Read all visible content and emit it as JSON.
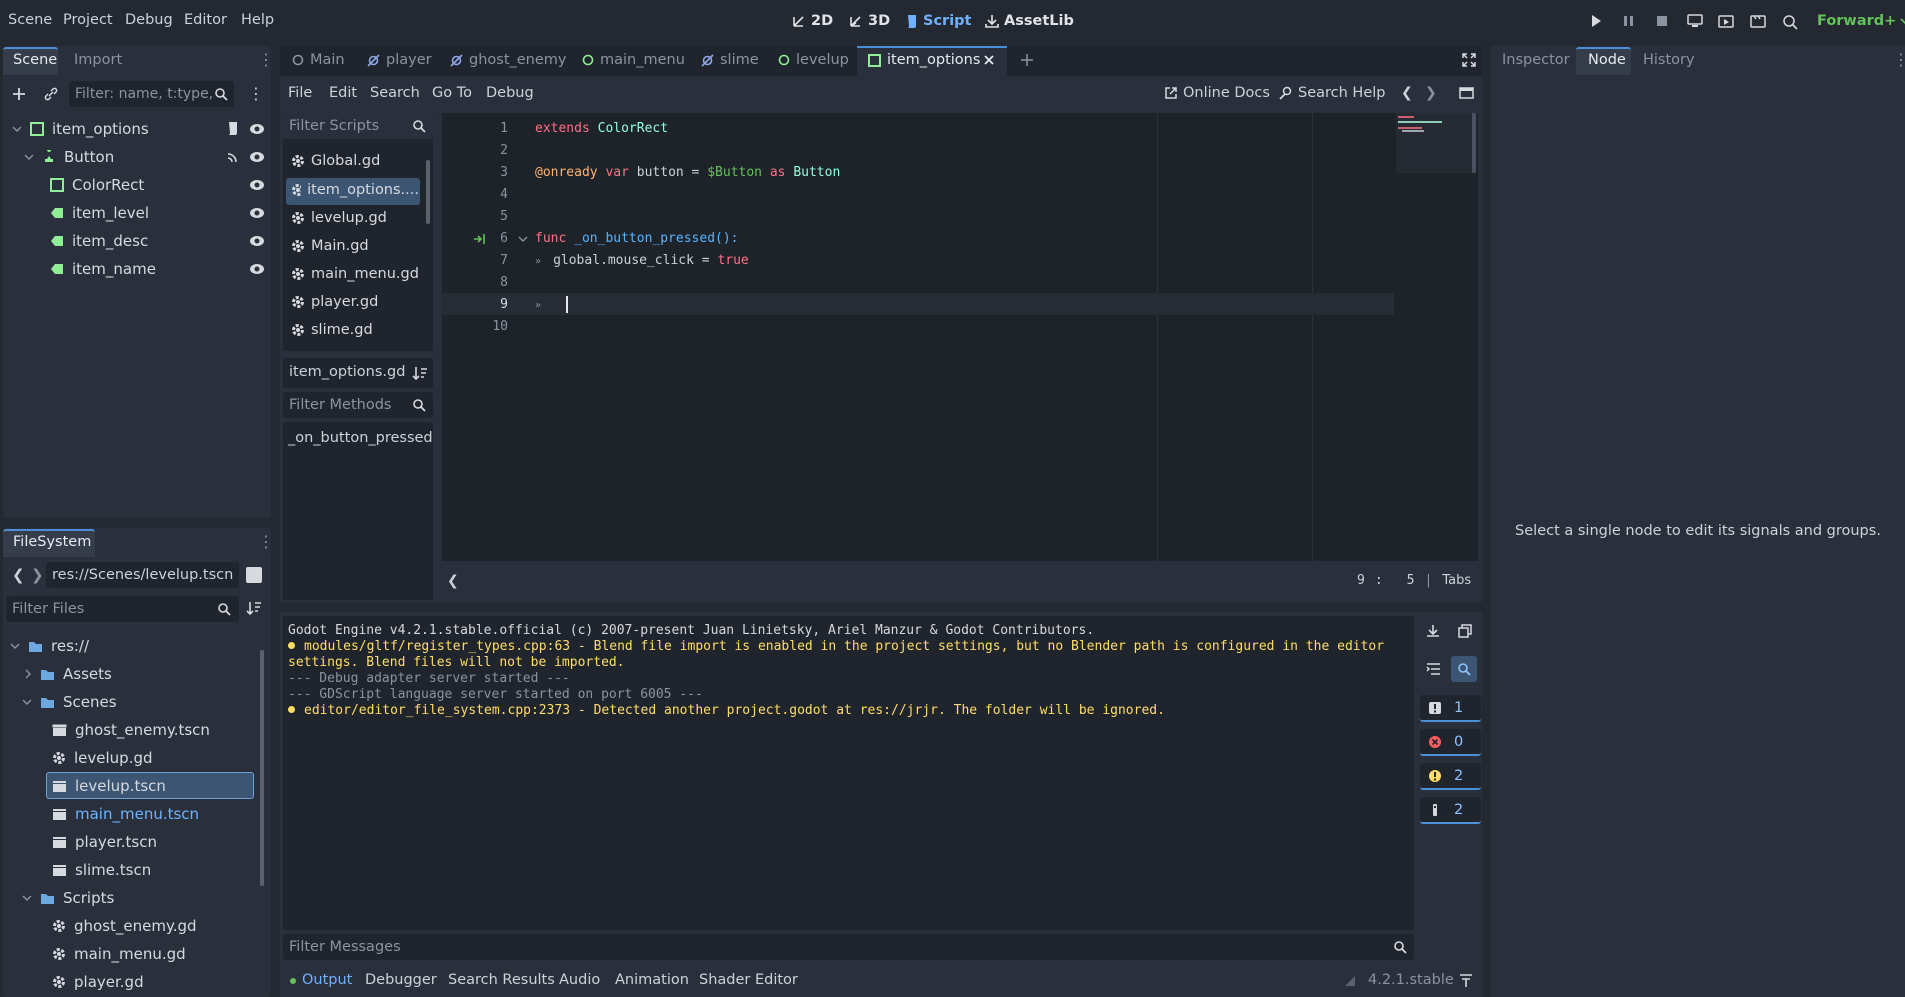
{
  "menu": {
    "scene": "Scene",
    "project": "Project",
    "debug": "Debug",
    "editor": "Editor",
    "help": "Help"
  },
  "workspaces": {
    "w2d": "2D",
    "w3d": "3D",
    "script": "Script",
    "assetlib": "AssetLib"
  },
  "renderer": "Forward+",
  "left_tabs": {
    "scene": "Scene",
    "import": "Import"
  },
  "scene_filter_placeholder": "Filter: name, t:type,",
  "scene_tree": [
    {
      "label": "item_options",
      "type": "ColorRect"
    },
    {
      "label": "Button",
      "type": "Button"
    },
    {
      "label": "ColorRect",
      "type": "ColorRect"
    },
    {
      "label": "item_level",
      "type": "Label"
    },
    {
      "label": "item_desc",
      "type": "Label"
    },
    {
      "label": "item_name",
      "type": "Label"
    }
  ],
  "filesystem": {
    "title": "FileSystem",
    "path": "res://Scenes/levelup.tscn",
    "filter_placeholder": "Filter Files",
    "items": [
      {
        "label": "res://",
        "kind": "folder"
      },
      {
        "label": "Assets",
        "kind": "folder"
      },
      {
        "label": "Scenes",
        "kind": "folder"
      },
      {
        "label": "ghost_enemy.tscn",
        "kind": "scene"
      },
      {
        "label": "levelup.gd",
        "kind": "script"
      },
      {
        "label": "levelup.tscn",
        "kind": "scene",
        "selected": true
      },
      {
        "label": "main_menu.tscn",
        "kind": "scene",
        "main": true
      },
      {
        "label": "player.tscn",
        "kind": "scene"
      },
      {
        "label": "slime.tscn",
        "kind": "scene"
      },
      {
        "label": "Scripts",
        "kind": "folder"
      },
      {
        "label": "ghost_enemy.gd",
        "kind": "script"
      },
      {
        "label": "main_menu.gd",
        "kind": "script"
      },
      {
        "label": "player.gd",
        "kind": "script"
      }
    ]
  },
  "scene_tabs": [
    "Main",
    "player",
    "ghost_enemy",
    "main_menu",
    "slime",
    "levelup",
    "item_options"
  ],
  "script_menu": {
    "file": "File",
    "edit": "Edit",
    "search": "Search",
    "goto": "Go To",
    "debug": "Debug",
    "online_docs": "Online Docs",
    "search_help": "Search Help"
  },
  "scripts_panel": {
    "filter_placeholder": "Filter Scripts",
    "items": [
      "Global.gd",
      "item_options....",
      "levelup.gd",
      "Main.gd",
      "main_menu.gd",
      "player.gd",
      "slime.gd"
    ],
    "current": "item_options.gd",
    "methods_placeholder": "Filter Methods",
    "methods": [
      "_on_button_pressed"
    ]
  },
  "code_lines": {
    "l1a": "extends",
    "l1b": "ColorRect",
    "l3a": "@onready",
    "l3b": "var",
    "l3c": "button = ",
    "l3d": "$Button",
    "l3e": "as",
    "l3f": "Button",
    "l6a": "func",
    "l6b": "_on_button_pressed():",
    "l7a": "global.mouse_click = ",
    "l7b": "true"
  },
  "line_numbers": [
    "1",
    "2",
    "3",
    "4",
    "5",
    "6",
    "7",
    "8",
    "9",
    "10"
  ],
  "cursor": {
    "line": "9",
    "sep": ":",
    "col": "5",
    "indent": "Tabs"
  },
  "output_lines": [
    {
      "text": "Godot Engine v4.2.1.stable.official (c) 2007-present Juan Linietsky, Ariel Manzur & Godot Contributors.",
      "kind": "info"
    },
    {
      "text": "modules/gltf/register_types.cpp:63 - Blend file import is enabled in the project settings, but no Blender path is configured in the editor",
      "kind": "warn"
    },
    {
      "text": "settings. Blend files will not be imported.",
      "kind": "warn-cont"
    },
    {
      "text": "--- Debug adapter server started ---",
      "kind": "dim"
    },
    {
      "text": "--- GDScript language server started on port 6005 ---",
      "kind": "dim"
    },
    {
      "text": "editor/editor_file_system.cpp:2373 - Detected another project.godot at res://jrjr. The folder will be ignored.",
      "kind": "warn"
    }
  ],
  "counters": {
    "messages": "1",
    "errors": "0",
    "warnings": "2",
    "editor": "2"
  },
  "filter_messages_placeholder": "Filter Messages",
  "bottom_tabs": [
    "Output",
    "Debugger",
    "Search Results",
    "Audio",
    "Animation",
    "Shader Editor"
  ],
  "version": "4.2.1.stable",
  "right_tabs": {
    "inspector": "Inspector",
    "node": "Node",
    "history": "History"
  },
  "node_hint": "Select a single node to edit its signals and groups.",
  "colors": {
    "accent": "#4a8fd8",
    "bg": "#232831",
    "panel": "#2a303b",
    "warning": "#ffdd65",
    "error": "#ff5d5d",
    "green": "#63c259"
  }
}
